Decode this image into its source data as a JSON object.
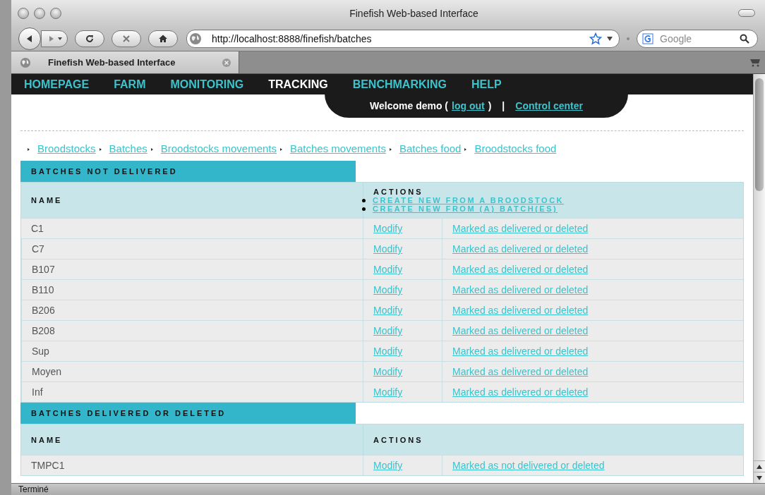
{
  "window": {
    "title": "Finefish Web-based Interface"
  },
  "toolbar": {
    "url": "http://localhost:8888/finefish/batches",
    "search_placeholder": "Google"
  },
  "tabs": [
    {
      "label": "Finefish Web-based Interface",
      "selected": true
    }
  ],
  "nav": [
    {
      "label": "HOMEPAGE",
      "selected": false
    },
    {
      "label": "FARM",
      "selected": false
    },
    {
      "label": "MONITORING",
      "selected": false
    },
    {
      "label": "TRACKING",
      "selected": true
    },
    {
      "label": "BENCHMARKING",
      "selected": false
    },
    {
      "label": "HELP",
      "selected": false
    }
  ],
  "user_bar": {
    "welcome": "Welcome demo (",
    "logout": "log out",
    "close_paren": ")",
    "separator": "|",
    "control_center": "Control center"
  },
  "breadcrumbs": [
    "Broodstocks",
    "Batches",
    "Broodstocks movements",
    "Batches movements",
    "Batches food",
    "Broodstocks food"
  ],
  "sections": [
    {
      "title": "BATCHES NOT DELIVERED",
      "name_header": "NAME",
      "actions_header": "ACTIONS",
      "actions": [
        "CREATE NEW FROM A BROODSTOCK",
        "CREATE NEW FROM (A) BATCH(ES)"
      ],
      "rows": [
        {
          "name": "C1",
          "modify": "Modify",
          "status_action": "Marked as delivered or deleted"
        },
        {
          "name": "C7",
          "modify": "Modify",
          "status_action": "Marked as delivered or deleted"
        },
        {
          "name": "B107",
          "modify": "Modify",
          "status_action": "Marked as delivered or deleted"
        },
        {
          "name": "B110",
          "modify": "Modify",
          "status_action": "Marked as delivered or deleted"
        },
        {
          "name": "B206",
          "modify": "Modify",
          "status_action": "Marked as delivered or deleted"
        },
        {
          "name": "B208",
          "modify": "Modify",
          "status_action": "Marked as delivered or deleted"
        },
        {
          "name": "Sup",
          "modify": "Modify",
          "status_action": "Marked as delivered or deleted"
        },
        {
          "name": "Moyen",
          "modify": "Modify",
          "status_action": "Marked as delivered or deleted"
        },
        {
          "name": "Inf",
          "modify": "Modify",
          "status_action": "Marked as delivered or deleted"
        }
      ]
    },
    {
      "title": "BATCHES DELIVERED OR DELETED",
      "name_header": "NAME",
      "actions_header": "ACTIONS",
      "rows": [
        {
          "name": "TMPC1",
          "modify": "Modify",
          "status_action": "Marked as not delivered or deleted"
        }
      ]
    }
  ],
  "status_bar": "Terminé"
}
